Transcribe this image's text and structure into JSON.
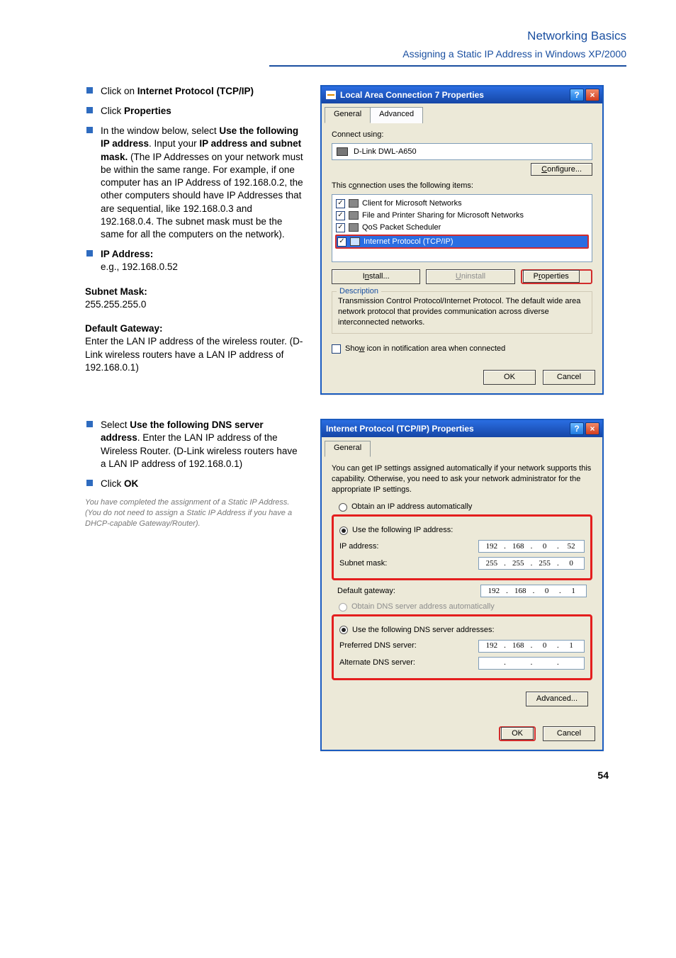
{
  "header": {
    "title": "Networking Basics",
    "subtitle": "Assigning a Static IP Address in Windows XP/2000",
    "pagenum": "54"
  },
  "left1": {
    "b1a": "Click on ",
    "b1b": "Internet Protocol (TCP/IP)",
    "b2a": "Click ",
    "b2b": "Properties",
    "b3p1a": "In the window below, select ",
    "b3p1b": "Use the following IP address",
    "b3p1c": ". Input your ",
    "b3p1d": "IP address and subnet mask.",
    "b3p1e": " (The IP Addresses on your network must be within the same range. For example, if one computer has an IP Address of 192.168.0.2, the other computers should have IP Addresses that are sequential, like 192.168.0.3 and 192.168.0.4. The subnet mask must be the same for all the computers on the network).",
    "b4a": "IP Address:",
    "b4b": "e.g., 192.168.0.52",
    "b5a": "Subnet Mask:",
    "b5b": "255.255.255.0",
    "b6a": "Default Gateway:",
    "b6b": "Enter the LAN IP address of the wireless router. (D-Link wireless routers have a LAN IP address of 192.168.0.1)"
  },
  "left2": {
    "b1a": "Select ",
    "b1b": "Use the following DNS server address",
    "b1c": ". Enter the LAN IP address of the Wireless Router. (D-Link wireless routers have a LAN IP address of 192.168.0.1)",
    "b2a": "Click ",
    "b2b": "OK"
  },
  "footnote": "You have completed the assignment of a Static IP Address.  (You do not need to assign a Static IP Address if you have a DHCP-capable Gateway/Router).",
  "dlg1": {
    "title": "Local Area Connection 7 Properties",
    "tab_general": "General",
    "tab_advanced": "Advanced",
    "connect_using": "Connect using:",
    "adapter": "D-Link DWL-A650",
    "configure": "Configure...",
    "uses_label": "This connection uses the following items:",
    "item_client": "Client for Microsoft Networks",
    "item_fps": "File and Printer Sharing for Microsoft Networks",
    "item_qos": "QoS Packet Scheduler",
    "item_tcpip": "Internet Protocol (TCP/IP)",
    "install": "Install...",
    "uninstall": "Uninstall",
    "properties": "Properties",
    "desc_legend": "Description",
    "desc_text": "Transmission Control Protocol/Internet Protocol. The default wide area network protocol that provides communication across diverse interconnected networks.",
    "show_icon": "Show icon in notification area when connected",
    "ok": "OK",
    "cancel": "Cancel"
  },
  "dlg2": {
    "title": "Internet Protocol (TCP/IP) Properties",
    "tab_general": "General",
    "intro": "You can get IP settings assigned automatically if your network supports this capability. Otherwise, you need to ask your network administrator for the appropriate IP settings.",
    "r_obtain_ip": "Obtain an IP address automatically",
    "r_use_ip": "Use the following IP address:",
    "lbl_ip": "IP address:",
    "ip": [
      "192",
      "168",
      "0",
      "52"
    ],
    "lbl_mask": "Subnet mask:",
    "mask": [
      "255",
      "255",
      "255",
      "0"
    ],
    "lbl_gw": "Default gateway:",
    "gw": [
      "192",
      "168",
      "0",
      "1"
    ],
    "r_obtain_dns": "Obtain DNS server address automatically",
    "r_use_dns": "Use the following DNS server addresses:",
    "lbl_pdns": "Preferred DNS server:",
    "pdns": [
      "192",
      "168",
      "0",
      "1"
    ],
    "lbl_adns": "Alternate DNS server:",
    "adns": [
      "",
      "",
      "",
      ""
    ],
    "advanced": "Advanced...",
    "ok": "OK",
    "cancel": "Cancel"
  }
}
